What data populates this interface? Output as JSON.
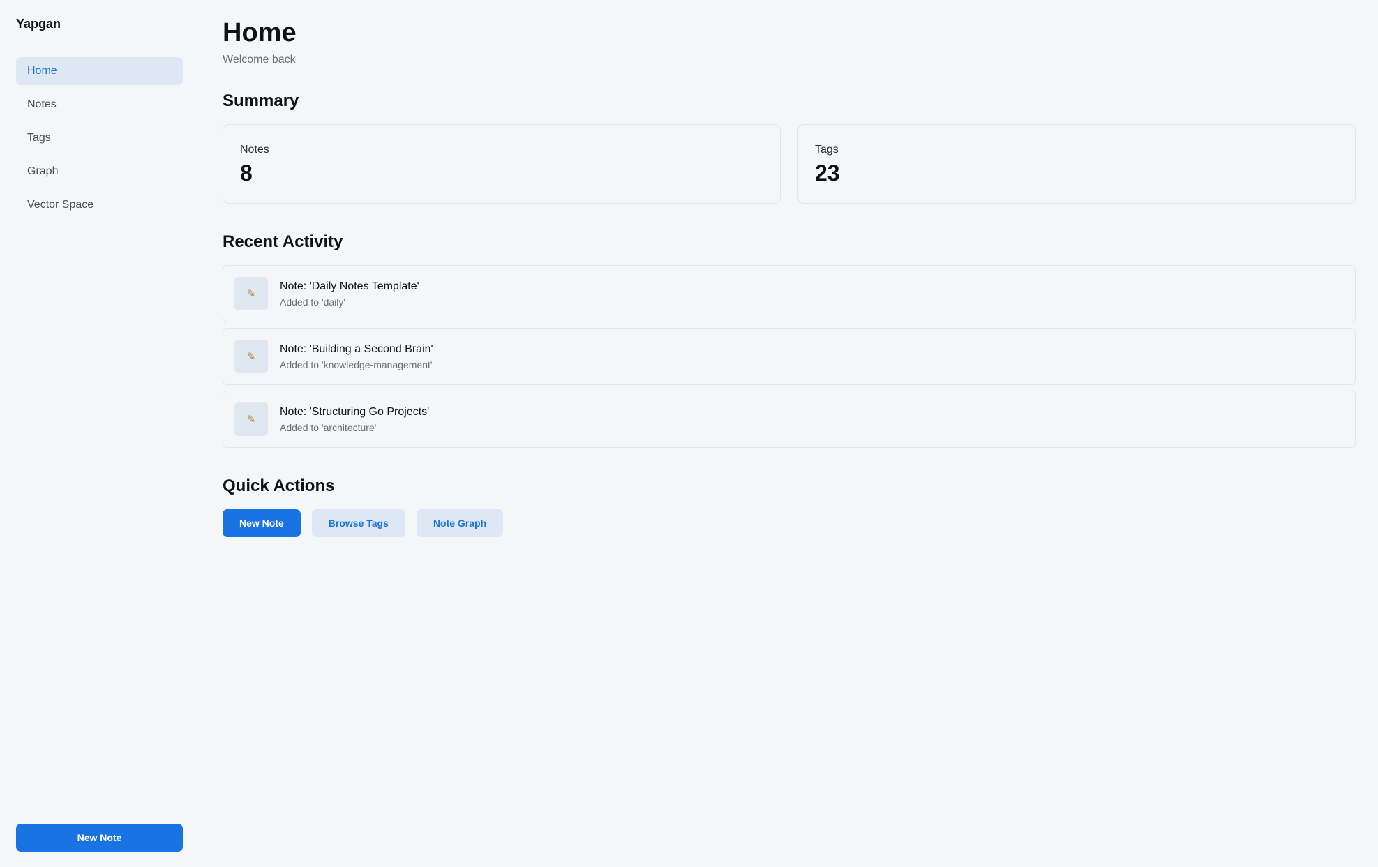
{
  "sidebar": {
    "brand": "Yapgan",
    "items": [
      {
        "label": "Home",
        "active": true
      },
      {
        "label": "Notes",
        "active": false
      },
      {
        "label": "Tags",
        "active": false
      },
      {
        "label": "Graph",
        "active": false
      },
      {
        "label": "Vector Space",
        "active": false
      }
    ],
    "new_note_label": "New Note"
  },
  "header": {
    "title": "Home",
    "subtitle": "Welcome back"
  },
  "summary": {
    "title": "Summary",
    "cards": [
      {
        "label": "Notes",
        "value": "8"
      },
      {
        "label": "Tags",
        "value": "23"
      }
    ]
  },
  "activity": {
    "title": "Recent Activity",
    "items": [
      {
        "icon": "memo-icon",
        "title": "Note: 'Daily Notes Template'",
        "subtitle": "Added to 'daily'"
      },
      {
        "icon": "memo-icon",
        "title": "Note: 'Building a Second Brain'",
        "subtitle": "Added to 'knowledge-management'"
      },
      {
        "icon": "memo-icon",
        "title": "Note: 'Structuring Go Projects'",
        "subtitle": "Added to 'architecture'"
      }
    ]
  },
  "quick_actions": {
    "title": "Quick Actions",
    "buttons": [
      {
        "label": "New Note"
      },
      {
        "label": "Browse Tags"
      },
      {
        "label": "Note Graph"
      }
    ]
  },
  "colors": {
    "accent": "#1a73e3",
    "accent_soft": "#dde8f4",
    "background": "#f4f6f7"
  }
}
